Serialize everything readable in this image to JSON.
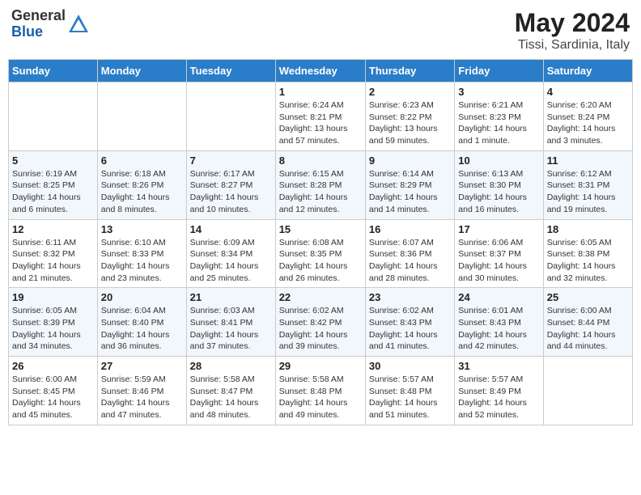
{
  "header": {
    "logo_general": "General",
    "logo_blue": "Blue",
    "title": "May 2024",
    "location": "Tissi, Sardinia, Italy"
  },
  "weekdays": [
    "Sunday",
    "Monday",
    "Tuesday",
    "Wednesday",
    "Thursday",
    "Friday",
    "Saturday"
  ],
  "weeks": [
    [
      {
        "num": "",
        "info": ""
      },
      {
        "num": "",
        "info": ""
      },
      {
        "num": "",
        "info": ""
      },
      {
        "num": "1",
        "info": "Sunrise: 6:24 AM\nSunset: 8:21 PM\nDaylight: 13 hours\nand 57 minutes."
      },
      {
        "num": "2",
        "info": "Sunrise: 6:23 AM\nSunset: 8:22 PM\nDaylight: 13 hours\nand 59 minutes."
      },
      {
        "num": "3",
        "info": "Sunrise: 6:21 AM\nSunset: 8:23 PM\nDaylight: 14 hours\nand 1 minute."
      },
      {
        "num": "4",
        "info": "Sunrise: 6:20 AM\nSunset: 8:24 PM\nDaylight: 14 hours\nand 3 minutes."
      }
    ],
    [
      {
        "num": "5",
        "info": "Sunrise: 6:19 AM\nSunset: 8:25 PM\nDaylight: 14 hours\nand 6 minutes."
      },
      {
        "num": "6",
        "info": "Sunrise: 6:18 AM\nSunset: 8:26 PM\nDaylight: 14 hours\nand 8 minutes."
      },
      {
        "num": "7",
        "info": "Sunrise: 6:17 AM\nSunset: 8:27 PM\nDaylight: 14 hours\nand 10 minutes."
      },
      {
        "num": "8",
        "info": "Sunrise: 6:15 AM\nSunset: 8:28 PM\nDaylight: 14 hours\nand 12 minutes."
      },
      {
        "num": "9",
        "info": "Sunrise: 6:14 AM\nSunset: 8:29 PM\nDaylight: 14 hours\nand 14 minutes."
      },
      {
        "num": "10",
        "info": "Sunrise: 6:13 AM\nSunset: 8:30 PM\nDaylight: 14 hours\nand 16 minutes."
      },
      {
        "num": "11",
        "info": "Sunrise: 6:12 AM\nSunset: 8:31 PM\nDaylight: 14 hours\nand 19 minutes."
      }
    ],
    [
      {
        "num": "12",
        "info": "Sunrise: 6:11 AM\nSunset: 8:32 PM\nDaylight: 14 hours\nand 21 minutes."
      },
      {
        "num": "13",
        "info": "Sunrise: 6:10 AM\nSunset: 8:33 PM\nDaylight: 14 hours\nand 23 minutes."
      },
      {
        "num": "14",
        "info": "Sunrise: 6:09 AM\nSunset: 8:34 PM\nDaylight: 14 hours\nand 25 minutes."
      },
      {
        "num": "15",
        "info": "Sunrise: 6:08 AM\nSunset: 8:35 PM\nDaylight: 14 hours\nand 26 minutes."
      },
      {
        "num": "16",
        "info": "Sunrise: 6:07 AM\nSunset: 8:36 PM\nDaylight: 14 hours\nand 28 minutes."
      },
      {
        "num": "17",
        "info": "Sunrise: 6:06 AM\nSunset: 8:37 PM\nDaylight: 14 hours\nand 30 minutes."
      },
      {
        "num": "18",
        "info": "Sunrise: 6:05 AM\nSunset: 8:38 PM\nDaylight: 14 hours\nand 32 minutes."
      }
    ],
    [
      {
        "num": "19",
        "info": "Sunrise: 6:05 AM\nSunset: 8:39 PM\nDaylight: 14 hours\nand 34 minutes."
      },
      {
        "num": "20",
        "info": "Sunrise: 6:04 AM\nSunset: 8:40 PM\nDaylight: 14 hours\nand 36 minutes."
      },
      {
        "num": "21",
        "info": "Sunrise: 6:03 AM\nSunset: 8:41 PM\nDaylight: 14 hours\nand 37 minutes."
      },
      {
        "num": "22",
        "info": "Sunrise: 6:02 AM\nSunset: 8:42 PM\nDaylight: 14 hours\nand 39 minutes."
      },
      {
        "num": "23",
        "info": "Sunrise: 6:02 AM\nSunset: 8:43 PM\nDaylight: 14 hours\nand 41 minutes."
      },
      {
        "num": "24",
        "info": "Sunrise: 6:01 AM\nSunset: 8:43 PM\nDaylight: 14 hours\nand 42 minutes."
      },
      {
        "num": "25",
        "info": "Sunrise: 6:00 AM\nSunset: 8:44 PM\nDaylight: 14 hours\nand 44 minutes."
      }
    ],
    [
      {
        "num": "26",
        "info": "Sunrise: 6:00 AM\nSunset: 8:45 PM\nDaylight: 14 hours\nand 45 minutes."
      },
      {
        "num": "27",
        "info": "Sunrise: 5:59 AM\nSunset: 8:46 PM\nDaylight: 14 hours\nand 47 minutes."
      },
      {
        "num": "28",
        "info": "Sunrise: 5:58 AM\nSunset: 8:47 PM\nDaylight: 14 hours\nand 48 minutes."
      },
      {
        "num": "29",
        "info": "Sunrise: 5:58 AM\nSunset: 8:48 PM\nDaylight: 14 hours\nand 49 minutes."
      },
      {
        "num": "30",
        "info": "Sunrise: 5:57 AM\nSunset: 8:48 PM\nDaylight: 14 hours\nand 51 minutes."
      },
      {
        "num": "31",
        "info": "Sunrise: 5:57 AM\nSunset: 8:49 PM\nDaylight: 14 hours\nand 52 minutes."
      },
      {
        "num": "",
        "info": ""
      }
    ]
  ]
}
